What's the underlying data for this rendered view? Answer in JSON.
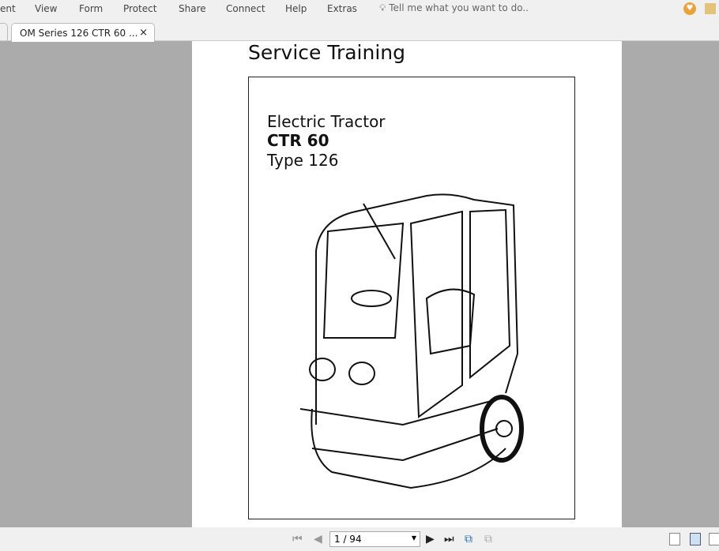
{
  "menu": {
    "items": [
      "ent",
      "View",
      "Form",
      "Protect",
      "Share",
      "Connect",
      "Help",
      "Extras"
    ],
    "tell_me": "Tell me what you want to do.."
  },
  "tab": {
    "label": "OM Series 126 CTR 60 ...",
    "close": "×"
  },
  "document": {
    "header": "Service Training",
    "subtitle": "Electric Tractor",
    "model": "CTR 60",
    "type": "Type 126"
  },
  "nav": {
    "page": "1 / 94"
  }
}
